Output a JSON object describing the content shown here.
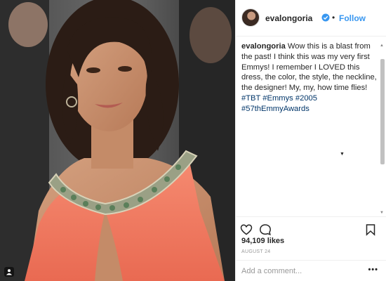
{
  "post": {
    "username": "evalongoria",
    "follow_label": "Follow",
    "separator": "•",
    "caption_text": "Wow this is a blast from the past! I think this was my very first Emmys! I remember I LOVED this dress, the color, the style, the neckline, the designer! My, my, how time flies!",
    "hashtags": [
      "#TBT",
      "#Emmys",
      "#2005",
      "#57thEmmyAwards"
    ],
    "likes": "94,109 likes",
    "date": "August 24",
    "comment_placeholder": "Add a comment...",
    "more_label": "•••"
  },
  "icons": {
    "verified": "verified-badge-icon",
    "like": "heart-icon",
    "comment": "speech-bubble-icon",
    "save": "bookmark-icon",
    "tagged": "person-tag-icon"
  },
  "colors": {
    "accent": "#3897f0",
    "hashtag": "#003569",
    "dress": "#f07a60"
  }
}
